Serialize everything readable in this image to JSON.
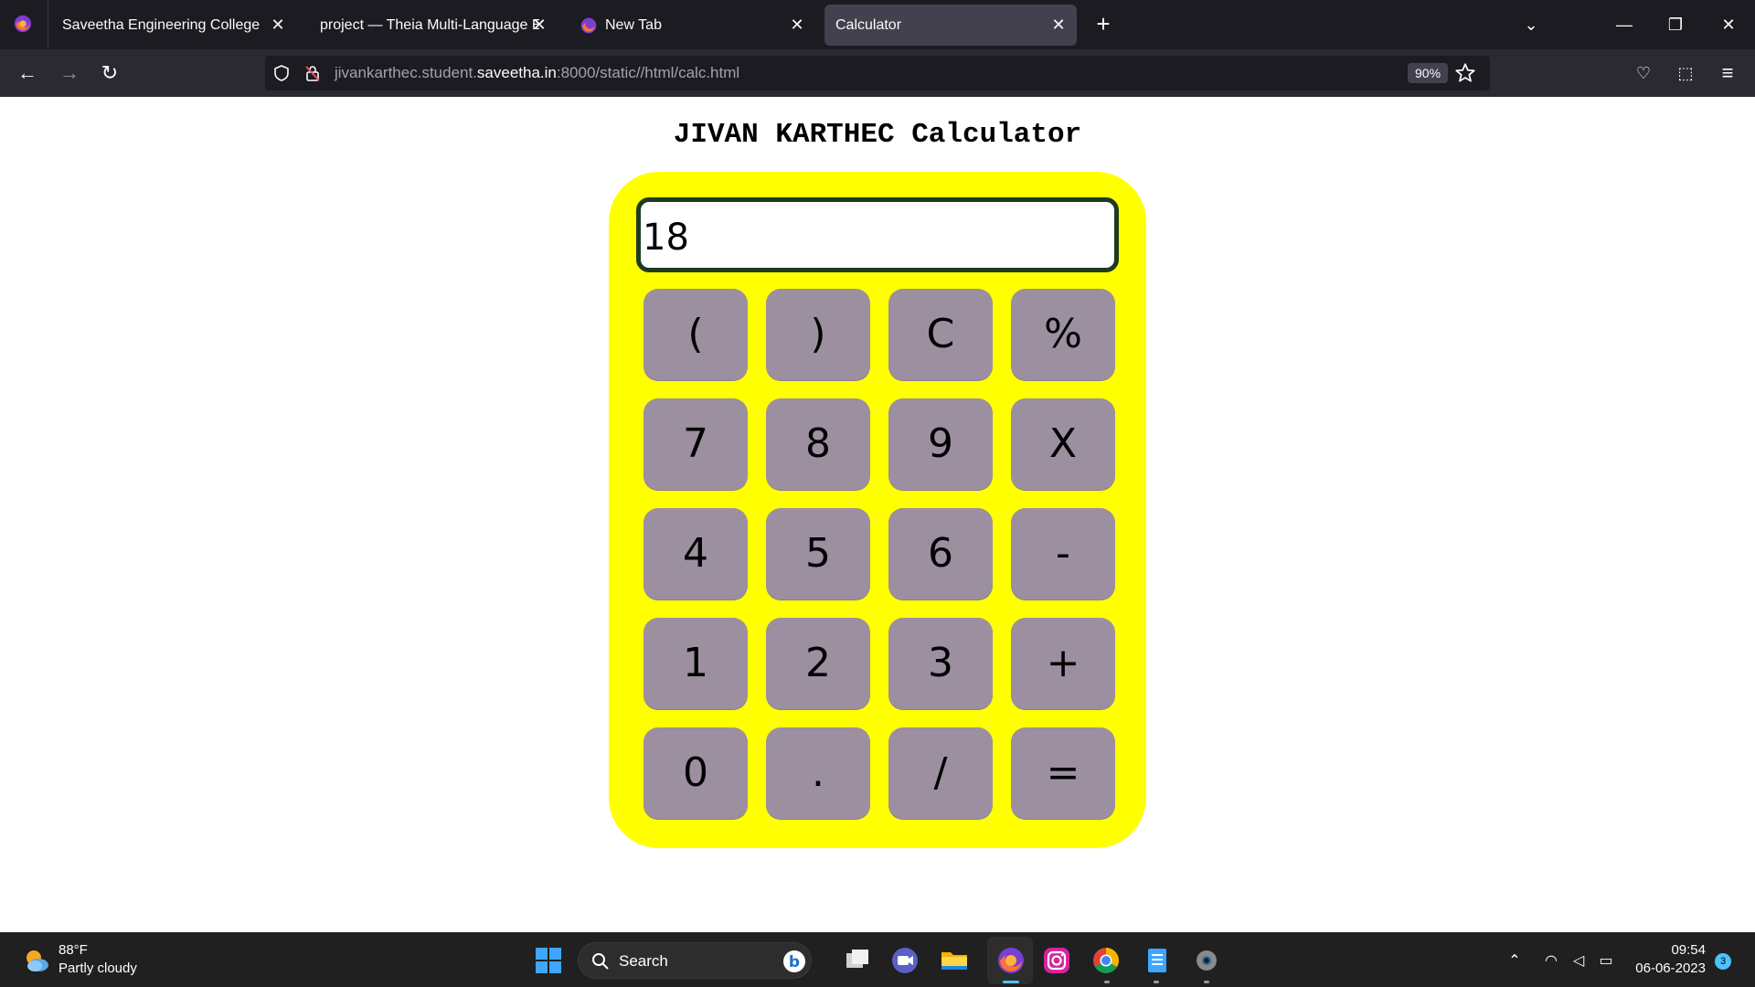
{
  "browser": {
    "tabs": [
      {
        "label": "Saveetha Engineering College",
        "active": false
      },
      {
        "label": "project — Theia Multi-Language Ex",
        "active": false
      },
      {
        "label": "New Tab",
        "active": false
      },
      {
        "label": "Calculator",
        "active": true
      }
    ],
    "close_glyph": "✕",
    "new_tab_glyph": "+",
    "url_prefix": "jivankarthec.student.",
    "url_domain": "saveetha.in",
    "url_suffix": ":8000/static//html/calc.html",
    "zoom": "90%"
  },
  "page": {
    "title": "JIVAN KARTHEC Calculator",
    "display_value": "18",
    "keys": [
      [
        "(",
        ")",
        "C",
        "%"
      ],
      [
        "7",
        "8",
        "9",
        "X"
      ],
      [
        "4",
        "5",
        "6",
        "-"
      ],
      [
        "1",
        "2",
        "3",
        "+"
      ],
      [
        "0",
        ".",
        "/",
        "="
      ]
    ]
  },
  "taskbar": {
    "weather_temp": "88°F",
    "weather_desc": "Partly cloudy",
    "search_label": "Search",
    "time": "09:54",
    "date": "06-06-2023",
    "notification_count": "3"
  },
  "colors": {
    "calc_body": "#ffff00",
    "key_bg": "#9b8fa0",
    "display_border": "#1f3a1f"
  }
}
